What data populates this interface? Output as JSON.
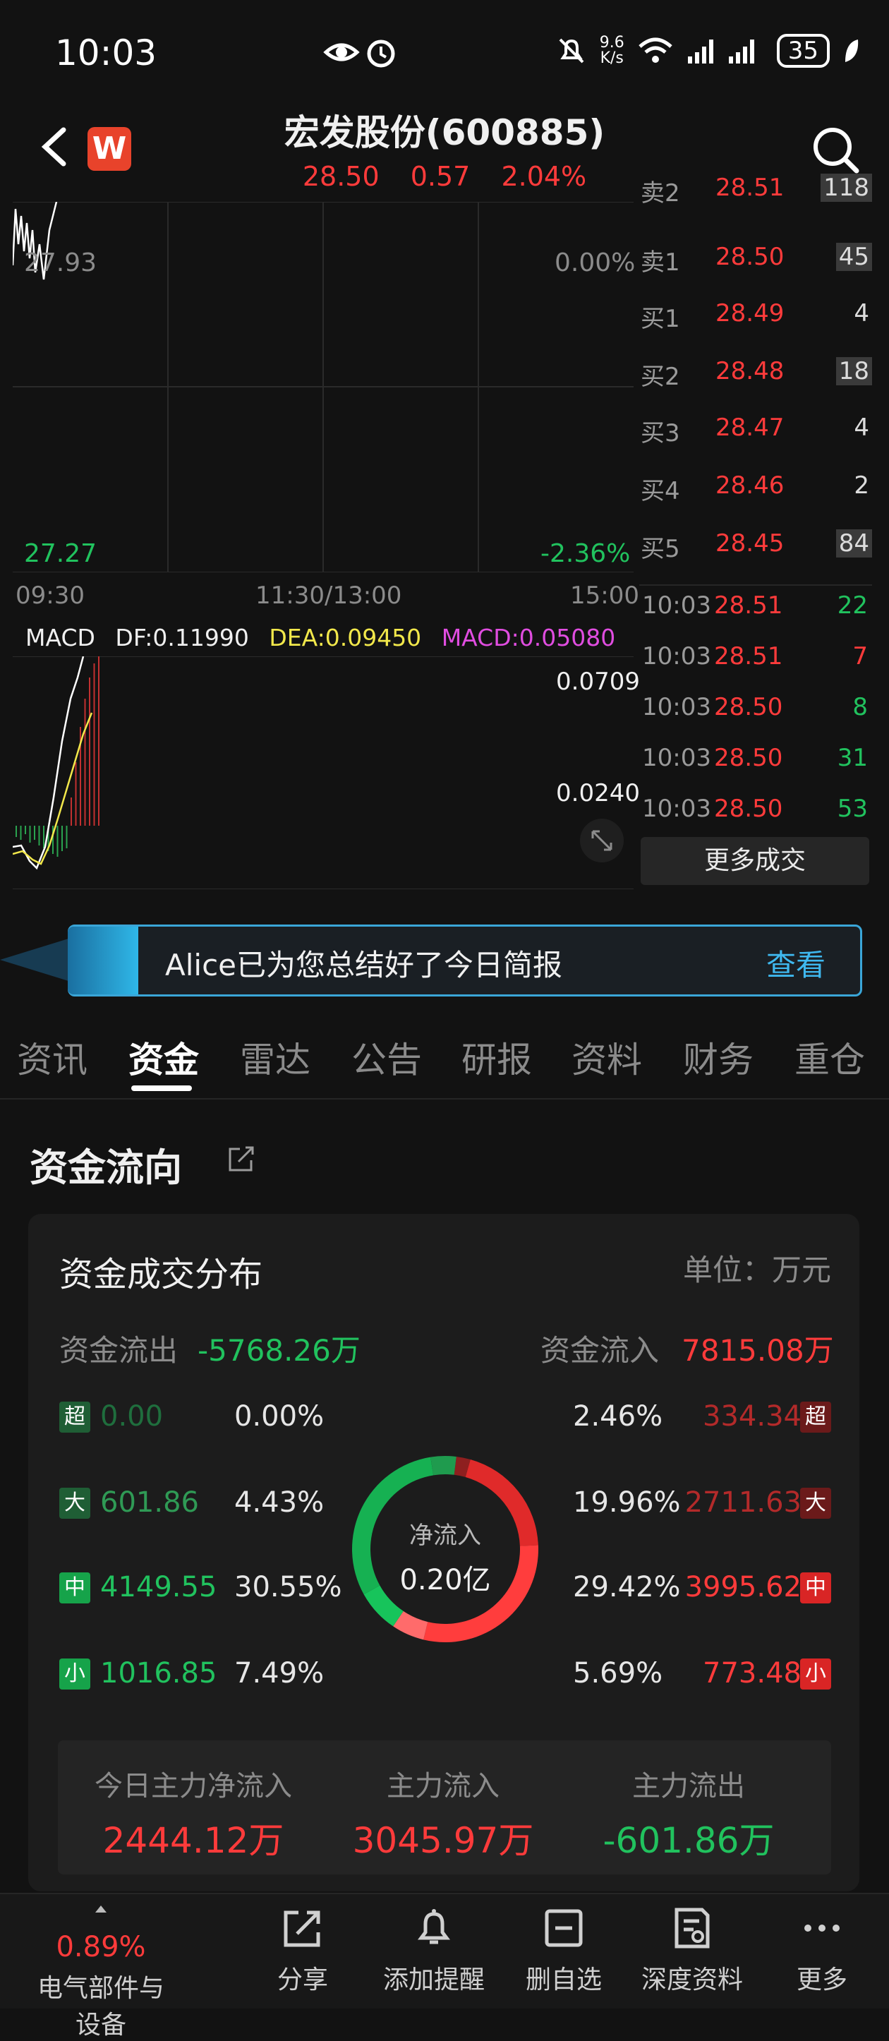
{
  "status": {
    "time": "10:03",
    "net_speed": "9.6",
    "net_unit": "K/s",
    "battery": "35"
  },
  "header": {
    "logo": "W",
    "title": "宏发股份(600885)",
    "price": "28.50",
    "change": "0.57",
    "change_pct": "2.04%"
  },
  "chart": {
    "ref_price": "27.93",
    "ref_pct": "0.00%",
    "low_price": "27.27",
    "low_pct": "-2.36%",
    "time_start": "09:30",
    "time_mid": "11:30/13:00",
    "time_end": "15:00"
  },
  "macd": {
    "label": "MACD",
    "df": "DF:0.11990",
    "dea": "DEA:0.09450",
    "macd": "MACD:0.05080",
    "top_value": "0.0709",
    "mid_value": "0.0240",
    "colors": {
      "df": "#f0f0f0",
      "dea": "#f2e84b",
      "macd": "#e04de0"
    }
  },
  "orderbook": [
    {
      "label": "卖2",
      "price": "28.51",
      "vol": "118"
    },
    {
      "label": "卖1",
      "price": "28.50",
      "vol": "45"
    },
    {
      "label": "买1",
      "price": "28.49",
      "vol": "4"
    },
    {
      "label": "买2",
      "price": "28.48",
      "vol": "18"
    },
    {
      "label": "买3",
      "price": "28.47",
      "vol": "4"
    },
    {
      "label": "买4",
      "price": "28.46",
      "vol": "2"
    },
    {
      "label": "买5",
      "price": "28.45",
      "vol": "84"
    }
  ],
  "trades": [
    {
      "time": "10:03",
      "price": "28.51",
      "vol": "22",
      "color": "green"
    },
    {
      "time": "10:03",
      "price": "28.51",
      "vol": "7",
      "color": "red"
    },
    {
      "time": "10:03",
      "price": "28.50",
      "vol": "8",
      "color": "green"
    },
    {
      "time": "10:03",
      "price": "28.50",
      "vol": "31",
      "color": "green"
    },
    {
      "time": "10:03",
      "price": "28.50",
      "vol": "53",
      "color": "green"
    }
  ],
  "more_trades": "更多成交",
  "banner": {
    "text": "Alice已为您总结好了今日简报",
    "link": "查看"
  },
  "tabs": [
    "资讯",
    "资金",
    "雷达",
    "公告",
    "研报",
    "资料",
    "财务",
    "重仓"
  ],
  "active_tab": 1,
  "section_title": "资金流向",
  "card": {
    "title": "资金成交分布",
    "unit": "单位：万元",
    "outflow_label": "资金流出",
    "outflow_value": "-5768.26万",
    "inflow_label": "资金流入",
    "inflow_value": "7815.08万",
    "rows": [
      {
        "badge": "超",
        "out": "0.00",
        "out_pct": "0.00%",
        "in_pct": "2.46%",
        "in": "334.34"
      },
      {
        "badge": "大",
        "out": "601.86",
        "out_pct": "4.43%",
        "in_pct": "19.96%",
        "in": "2711.63"
      },
      {
        "badge": "中",
        "out": "4149.55",
        "out_pct": "30.55%",
        "in_pct": "29.42%",
        "in": "3995.62"
      },
      {
        "badge": "小",
        "out": "1016.85",
        "out_pct": "7.49%",
        "in_pct": "5.69%",
        "in": "773.48"
      }
    ],
    "donut_label": "净流入",
    "donut_value": "0.20亿",
    "summary": [
      {
        "label": "今日主力净流入",
        "value": "2444.12万",
        "color": "red"
      },
      {
        "label": "主力流入",
        "value": "3045.97万",
        "color": "red"
      },
      {
        "label": "主力流出",
        "value": "-601.86万",
        "color": "green"
      }
    ]
  },
  "bottom_bar": {
    "sector_pct": "0.89%",
    "sector_name": "电气部件与设备",
    "items": [
      "分享",
      "添加提醒",
      "删自选",
      "深度资料",
      "更多"
    ]
  }
}
